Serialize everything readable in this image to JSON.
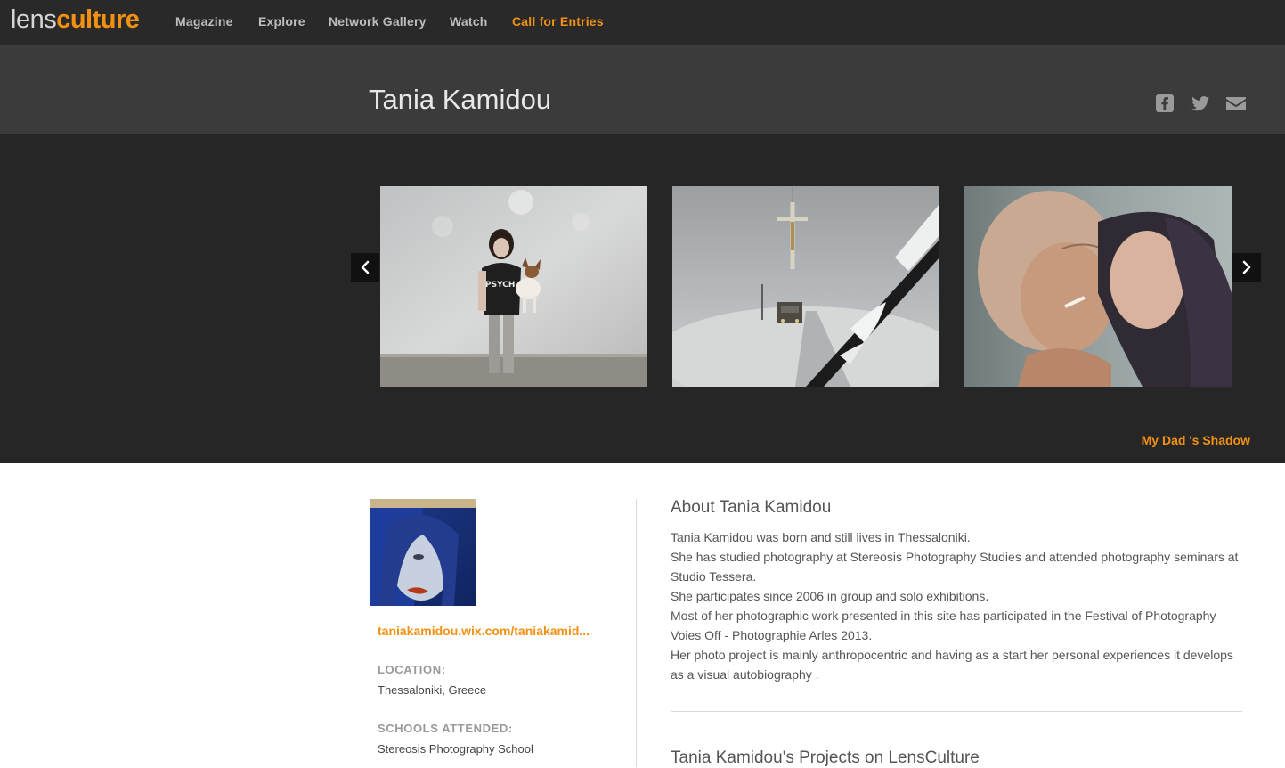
{
  "nav": {
    "logo_lens": "lens",
    "logo_culture": "culture",
    "items": [
      "Magazine",
      "Explore",
      "Network Gallery",
      "Watch"
    ],
    "cta": "Call for Entries",
    "accent_color": "#f29111"
  },
  "header": {
    "title": "Tania Kamidou",
    "share_icons": [
      "facebook-icon",
      "twitter-icon",
      "email-icon"
    ]
  },
  "gallery": {
    "photos": [
      "photo-woman-with-dog",
      "photo-crucifix-snow-road",
      "photo-women-cigarette"
    ],
    "prev_icon": "chevron-left-icon",
    "next_icon": "chevron-right-icon",
    "project_title": "My Dad 's Shadow"
  },
  "profile": {
    "website": "taniakamidou.wix.com/taniakamid...",
    "location_label": "LOCATION:",
    "location": "Thessaloniki, Greece",
    "schools_label": "SCHOOLS ATTENDED:",
    "school": "Stereosis Photography School"
  },
  "about": {
    "heading": "About Tania Kamidou",
    "paragraphs": [
      "Tania Kamidou was born and still lives in Thessaloniki.",
      "She has studied photography at Stereosis Photography Studies and attended photography seminars at Studio Tessera.",
      "She participates since 2006 in group and solo exhibitions.",
      "Most of her photographic work presented in this site has participated in the Festival of Photography Voies Off - Photographie Arles 2013.",
      "Her photo project is mainly anthropocentric and having as a start her personal experiences it develops as a visual autobiography ."
    ]
  },
  "projects": {
    "heading": "Tania Kamidou's Projects on LensCulture"
  }
}
